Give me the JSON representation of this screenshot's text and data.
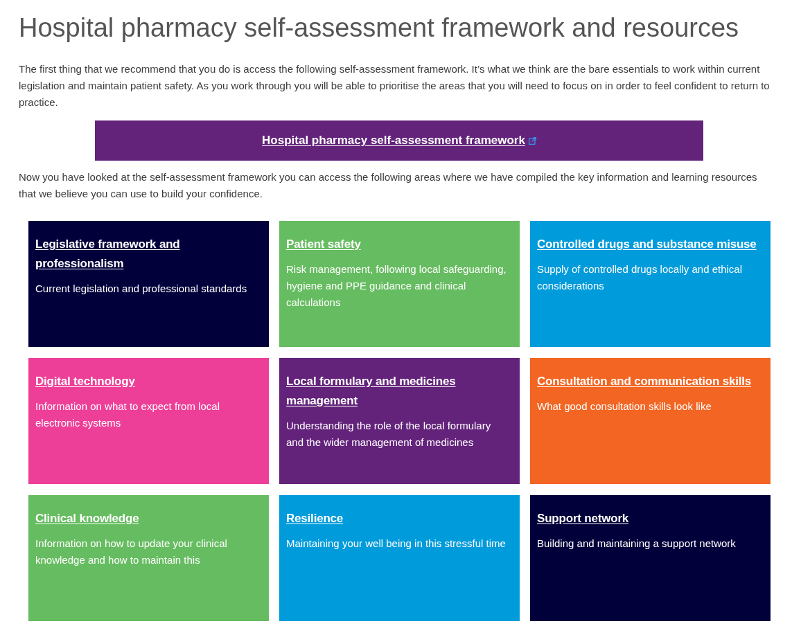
{
  "title": "Hospital pharmacy self-assessment framework and resources",
  "intro": "The first thing that we recommend that you do is access the following self-assessment framework. It’s what we think are the bare essentials to work within current legislation and maintain patient safety. As you work through you will be able to prioritise the areas that you will need to focus on in order to feel confident to return to practice.",
  "banner": {
    "link": "Hospital pharmacy self-assessment framework",
    "external": true
  },
  "followup": "Now you have looked at the self-assessment framework you can access the following areas where we have compiled the key information and learning resources that we believe you can use to build your confidence.",
  "cards": [
    {
      "title": "Legislative framework and professionalism",
      "description": "Current legislation and professional standards",
      "color": "#02003a"
    },
    {
      "title": "Patient safety",
      "description": "Risk management, following local safeguarding, hygiene and PPE guidance and clinical calculations",
      "color": "#66bc60"
    },
    {
      "title": "Controlled drugs and substance misuse",
      "description": "Supply of controlled drugs locally and ethical considerations",
      "color": "#009bdb"
    },
    {
      "title": "Digital technology",
      "description": "Information on what to expect from local electronic systems",
      "color": "#ee3f98"
    },
    {
      "title": "Local formulary and medicines management",
      "description": "Understanding the role of the local formulary and the wider management of medicines",
      "color": "#63237b"
    },
    {
      "title": "Consultation and communication skills",
      "description": "What good consultation skills look like",
      "color": "#f26522"
    },
    {
      "title": "Clinical knowledge",
      "description": "Information on how to update your clinical knowledge and how to maintain this",
      "color": "#66bc60"
    },
    {
      "title": "Resilience",
      "description": "Maintaining your well being in this stressful time",
      "color": "#009bdb"
    },
    {
      "title": "Support network",
      "description": "Building and maintaining a support network",
      "color": "#02003a"
    }
  ]
}
